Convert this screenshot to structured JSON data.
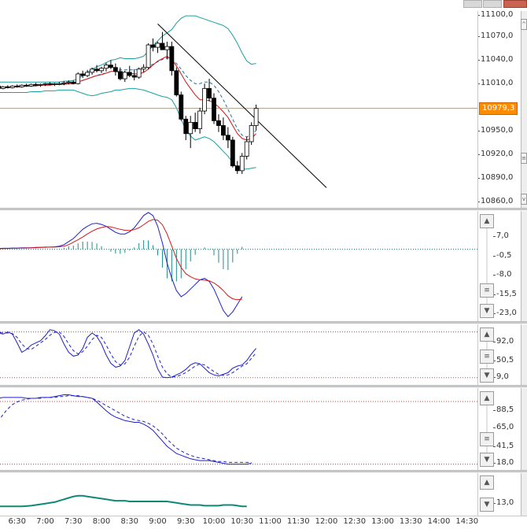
{
  "window": {
    "controls": [
      "minimize",
      "restore",
      "close"
    ]
  },
  "price_marker": {
    "label": "10979,3",
    "value": 10979.3,
    "color": "#ff8c00"
  },
  "x_axis": {
    "labels": [
      "6:30",
      "7:00",
      "7:30",
      "8:00",
      "8:30",
      "9:00",
      "9:30",
      "10:00",
      "10:30",
      "11:00",
      "11:30",
      "12:00",
      "12:30",
      "13:00",
      "13:30",
      "14:00",
      "14:30"
    ]
  },
  "panels": {
    "price": {
      "ticks": [
        "11100,0",
        "11070,0",
        "11040,0",
        "11010,0",
        "10950,0",
        "10920,0",
        "10890,0",
        "10860,0"
      ],
      "range": [
        10856,
        11100
      ]
    },
    "macd": {
      "ticks": [
        "7,0",
        "-0,5",
        "-8,0",
        "-15,5",
        "-23,0"
      ],
      "range": [
        -24,
        12
      ]
    },
    "stoch_fast": {
      "ticks": [
        "92,0",
        "50,5",
        "9,0"
      ],
      "range": [
        0,
        100
      ]
    },
    "stoch_slow": {
      "ticks": [
        "88,5",
        "65,0",
        "41,5",
        "18,0"
      ],
      "range": [
        15,
        100
      ]
    },
    "bottom": {
      "ticks": [
        "13,0"
      ],
      "range": [
        0,
        60
      ]
    }
  },
  "chart_data": [
    {
      "type": "candlestick",
      "x_start": "6:00",
      "x_step_minutes": 5,
      "ylim": [
        10856,
        11100
      ],
      "candles": [
        [
          11005,
          11008,
          11004,
          11006
        ],
        [
          11006,
          11009,
          11005,
          11007
        ],
        [
          11007,
          11008,
          11003,
          11004
        ],
        [
          11004,
          11007,
          11003,
          11006
        ],
        [
          11006,
          11008,
          11004,
          11005
        ],
        [
          11005,
          11008,
          11004,
          11007
        ],
        [
          11007,
          11009,
          11005,
          11006
        ],
        [
          11006,
          11009,
          11005,
          11008
        ],
        [
          11008,
          11010,
          11006,
          11007
        ],
        [
          11007,
          11010,
          11006,
          11009
        ],
        [
          11009,
          11011,
          11007,
          11008
        ],
        [
          11008,
          11010,
          11006,
          11009
        ],
        [
          11009,
          11011,
          11007,
          11010
        ],
        [
          11010,
          11012,
          11008,
          11009
        ],
        [
          11009,
          11011,
          11007,
          11010
        ],
        [
          11010,
          11012,
          11008,
          11010
        ],
        [
          11010,
          11013,
          11008,
          11011
        ],
        [
          11011,
          11014,
          11009,
          11012
        ],
        [
          11012,
          11014,
          11009,
          11010
        ],
        [
          11010,
          11024,
          11009,
          11022
        ],
        [
          11022,
          11026,
          11017,
          11020
        ],
        [
          11020,
          11027,
          11018,
          11024
        ],
        [
          11024,
          11030,
          11021,
          11028
        ],
        [
          11028,
          11033,
          11024,
          11026
        ],
        [
          11026,
          11031,
          11023,
          11029
        ],
        [
          11029,
          11036,
          11025,
          11033
        ],
        [
          11033,
          11039,
          11028,
          11030
        ],
        [
          11030,
          11035,
          11020,
          11025
        ],
        [
          11025,
          11030,
          11014,
          11016
        ],
        [
          11016,
          11026,
          11012,
          11024
        ],
        [
          11024,
          11032,
          11018,
          11020
        ],
        [
          11020,
          11028,
          11014,
          11018
        ],
        [
          11018,
          11030,
          11016,
          11028
        ],
        [
          11028,
          11034,
          11024,
          11030
        ],
        [
          11030,
          11060,
          11028,
          11058
        ],
        [
          11058,
          11066,
          11050,
          11055
        ],
        [
          11055,
          11062,
          11048,
          11060
        ],
        [
          11060,
          11074,
          11054,
          11052
        ],
        [
          11052,
          11062,
          11040,
          11056
        ],
        [
          11056,
          11062,
          11020,
          11026
        ],
        [
          11026,
          11030,
          10994,
          10996
        ],
        [
          10996,
          11000,
          10964,
          10966
        ],
        [
          10966,
          10970,
          10940,
          10948
        ],
        [
          10948,
          10970,
          10930,
          10962
        ],
        [
          10962,
          10974,
          10950,
          10954
        ],
        [
          10954,
          10980,
          10948,
          10976
        ],
        [
          10976,
          11010,
          10972,
          11004
        ],
        [
          11004,
          11016,
          10988,
          10992
        ],
        [
          10992,
          10998,
          10960,
          10964
        ],
        [
          10964,
          10972,
          10950,
          10958
        ],
        [
          10958,
          10968,
          10940,
          10946
        ],
        [
          10946,
          10956,
          10930,
          10940
        ],
        [
          10940,
          10944,
          10906,
          10908
        ],
        [
          10908,
          10914,
          10898,
          10902
        ],
        [
          10902,
          10924,
          10898,
          10920
        ],
        [
          10920,
          10944,
          10916,
          10938
        ],
        [
          10938,
          10962,
          10934,
          10958
        ],
        [
          10958,
          10984,
          10952,
          10979.3
        ]
      ],
      "bollinger_upper": [
        11012,
        11012,
        11012,
        11012,
        11012,
        11012,
        11012,
        11012,
        11012,
        11012,
        11012,
        11012,
        11012,
        11012,
        11012,
        11012,
        11013,
        11013,
        11014,
        11016,
        11020,
        11024,
        11028,
        11031,
        11033,
        11036,
        11039,
        11040,
        11042,
        11041,
        11041,
        11041,
        11042,
        11044,
        11050,
        11057,
        11063,
        11069,
        11073,
        11077,
        11085,
        11091,
        11094,
        11094,
        11094,
        11092,
        11090,
        11088,
        11086,
        11084,
        11082,
        11078,
        11070,
        11060,
        11048,
        11038,
        11034,
        11035
      ],
      "bollinger_lower": [
        10998,
        10998,
        10999,
        10999,
        10999,
        10999,
        10999,
        10999,
        10999,
        11000,
        11000,
        11000,
        11001,
        11001,
        11001,
        11002,
        11002,
        11002,
        11002,
        11000,
        10998,
        10996,
        10995,
        10996,
        10998,
        10999,
        11000,
        11002,
        11002,
        11003,
        11004,
        11004,
        11003,
        11002,
        11000,
        10998,
        10996,
        10994,
        10993,
        10990,
        10980,
        10966,
        10952,
        10945,
        10940,
        10942,
        10944,
        10942,
        10938,
        10932,
        10926,
        10920,
        10912,
        10906,
        10904,
        10904,
        10905,
        10906
      ],
      "ma_red": [
        11004,
        11005,
        11005,
        11005,
        11005,
        11006,
        11006,
        11006,
        11007,
        11007,
        11007,
        11008,
        11008,
        11008,
        11009,
        11009,
        11009,
        11010,
        11010,
        11012,
        11014,
        11016,
        11018,
        11020,
        11021,
        11023,
        11025,
        11025,
        11024,
        11024,
        11023,
        11022,
        11022,
        11024,
        11028,
        11033,
        11038,
        11041,
        11044,
        11040,
        11032,
        11022,
        11012,
        11004,
        10996,
        10990,
        10990,
        10989,
        10986,
        10981,
        10975,
        10968,
        10958,
        10948,
        10942,
        10940,
        10942,
        10948
      ],
      "ma_dash": [
        11006,
        11006,
        11006,
        11006,
        11006,
        11006,
        11007,
        11007,
        11007,
        11007,
        11008,
        11008,
        11008,
        11009,
        11009,
        11009,
        11010,
        11010,
        11010,
        11012,
        11014,
        11016,
        11018,
        11020,
        11022,
        11023,
        11025,
        11026,
        11027,
        11027,
        11027,
        11027,
        11028,
        11029,
        11031,
        11034,
        11037,
        11040,
        11042,
        11040,
        11035,
        11028,
        11020,
        11014,
        11010,
        11010,
        11012,
        11012,
        11008,
        11000,
        10990,
        10978,
        10966,
        10954,
        10946,
        10944,
        10946,
        10952
      ],
      "price_line": 10979.3,
      "trendline": [
        [
          9.0,
          11084
        ],
        [
          12.0,
          10881
        ]
      ]
    },
    {
      "type": "line",
      "x_start": "6:00",
      "x_step_minutes": 5,
      "ylim": [
        -24,
        12
      ],
      "series": [
        {
          "color": "#2020c8",
          "values": [
            -0.5,
            -0.4,
            -0.3,
            -0.2,
            -0.2,
            -0.1,
            -0.1,
            0,
            0,
            0,
            0.1,
            0.1,
            0.2,
            0.2,
            0.3,
            0.5,
            1.0,
            2.0,
            3.0,
            4.5,
            6.0,
            7.0,
            7.8,
            8.0,
            7.6,
            7.0,
            6.0,
            5.0,
            4.5,
            4.5,
            5.2,
            6.5,
            8.5,
            10.5,
            11.5,
            10.5,
            7.0,
            1.5,
            -5.0,
            -10.0,
            -14.0,
            -16.0,
            -15.0,
            -13.5,
            -12.0,
            -10.5,
            -10.0,
            -11.0,
            -13.5,
            -17.0,
            -20.5,
            -22.5,
            -21.0,
            -18.5,
            -16.0
          ]
        },
        {
          "color": "#d81818",
          "values": [
            -0.6,
            -0.5,
            -0.4,
            -0.3,
            -0.3,
            -0.2,
            -0.2,
            -0.1,
            -0.1,
            0,
            0,
            0.1,
            0.1,
            0.2,
            0.2,
            0.3,
            0.5,
            1.0,
            1.8,
            2.6,
            3.5,
            4.5,
            5.4,
            6.1,
            6.6,
            6.9,
            6.8,
            6.4,
            6.0,
            5.7,
            5.6,
            5.9,
            6.5,
            7.5,
            8.6,
            9.2,
            9.0,
            7.5,
            4.5,
            0.5,
            -3.5,
            -6.5,
            -8.5,
            -9.5,
            -10.2,
            -10.5,
            -10.6,
            -10.8,
            -11.5,
            -12.6,
            -14.0,
            -15.7,
            -16.7,
            -17.0,
            -16.8
          ]
        }
      ],
      "histogram": [
        0.1,
        0.1,
        0.1,
        0.1,
        0.1,
        0.1,
        0.1,
        0.1,
        0.1,
        0,
        0.1,
        0,
        0.1,
        0,
        0.1,
        0.2,
        0.5,
        1.0,
        1.2,
        1.9,
        2.5,
        2.5,
        2.4,
        1.9,
        1.0,
        0.1,
        -0.8,
        -1.4,
        -1.5,
        -1.2,
        -0.4,
        0.6,
        2.0,
        3.0,
        2.9,
        1.3,
        -2.0,
        -6.0,
        -9.5,
        -10.5,
        -10.5,
        -9.5,
        -6.5,
        -4.0,
        -1.8,
        0,
        0.6,
        -0.2,
        -2.0,
        -4.4,
        -6.5,
        -6.8,
        -4.3,
        -1.5,
        0.8
      ],
      "hist_color": "#1e8c8c",
      "zero_level": -0.5
    },
    {
      "type": "line",
      "x_start": "6:00",
      "x_step_minutes": 5,
      "ylim": [
        0,
        100
      ],
      "series": [
        {
          "color": "#2020c8",
          "values": [
            95,
            93,
            90,
            88,
            92,
            88,
            72,
            55,
            60,
            68,
            72,
            76,
            85,
            96,
            94,
            88,
            70,
            55,
            48,
            50,
            62,
            82,
            90,
            84,
            70,
            50,
            35,
            28,
            30,
            40,
            65,
            90,
            96,
            88,
            70,
            50,
            25,
            10,
            9,
            10,
            14,
            18,
            24,
            32,
            36,
            34,
            26,
            18,
            14,
            12,
            15,
            18,
            26,
            30,
            32,
            40,
            52,
            62
          ]
        },
        {
          "color": "#2020c8",
          "dashed": true,
          "values": [
            93,
            92,
            91,
            90,
            90,
            89,
            82,
            70,
            62,
            60,
            66,
            72,
            78,
            86,
            91,
            92,
            84,
            70,
            58,
            52,
            56,
            66,
            78,
            86,
            82,
            68,
            52,
            38,
            32,
            34,
            46,
            66,
            84,
            92,
            86,
            70,
            48,
            28,
            16,
            10,
            11,
            14,
            18,
            24,
            30,
            34,
            32,
            26,
            20,
            15,
            13,
            14,
            18,
            24,
            30,
            34,
            44,
            54
          ]
        }
      ],
      "levels": [
        92,
        9
      ]
    },
    {
      "type": "line",
      "x_start": "6:00",
      "x_step_minutes": 5,
      "ylim": [
        15,
        100
      ],
      "series": [
        {
          "color": "#2020c8",
          "values": [
            88,
            90,
            92,
            93,
            93,
            93,
            93,
            93,
            92,
            92,
            92,
            93,
            93,
            93,
            94,
            95,
            96,
            96,
            95,
            94,
            94,
            93,
            92,
            88,
            83,
            78,
            74,
            71,
            69,
            67,
            66,
            65,
            65,
            63,
            60,
            56,
            50,
            44,
            38,
            34,
            30,
            28,
            26,
            24,
            23,
            22,
            22,
            22,
            21,
            20,
            19,
            18,
            18,
            18,
            18,
            18,
            19
          ]
        },
        {
          "color": "#2020c8",
          "dashed": true,
          "values": [
            50,
            58,
            66,
            74,
            80,
            85,
            88,
            90,
            91,
            92,
            92,
            92,
            93,
            93,
            93,
            94,
            94,
            95,
            95,
            95,
            94,
            93,
            92,
            90,
            87,
            84,
            81,
            78,
            75,
            72,
            70,
            68,
            67,
            66,
            64,
            61,
            57,
            52,
            46,
            41,
            36,
            33,
            30,
            28,
            26,
            25,
            24,
            23,
            22,
            21,
            21,
            20,
            20,
            20,
            20,
            20,
            20
          ]
        }
      ],
      "levels": [
        88.5,
        18
      ]
    },
    {
      "type": "area",
      "x_start": "6:00",
      "x_step_minutes": 5,
      "ylim": [
        0,
        60
      ],
      "series": [
        {
          "color": "#108878",
          "values": [
            13,
            13,
            13,
            13,
            13,
            13,
            13,
            13,
            13.5,
            14,
            15,
            16,
            17,
            18,
            19,
            21,
            23,
            25,
            27,
            28,
            28,
            27,
            26,
            25,
            24,
            23,
            22,
            21,
            21,
            21,
            20,
            20,
            20,
            20,
            20,
            20,
            20,
            20,
            20,
            19,
            18,
            17,
            16,
            15,
            15,
            15,
            14,
            14,
            14,
            14,
            15,
            15,
            15,
            14,
            13,
            13
          ]
        }
      ]
    }
  ]
}
